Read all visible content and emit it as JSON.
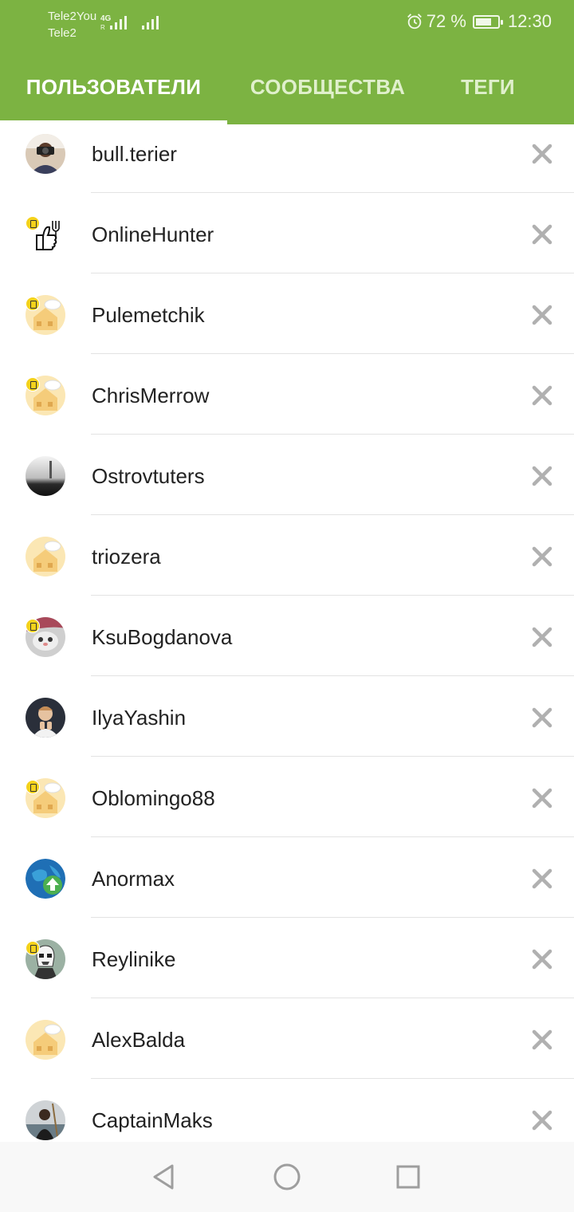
{
  "status_bar": {
    "carrier1": "Tele2You",
    "carrier2": "Tele2",
    "network_type": "4G",
    "roaming": "R",
    "battery_text": "72 %",
    "battery_level": 0.72,
    "time": "12:30"
  },
  "tabs": [
    {
      "label": "ПОЛЬЗОВАТЕЛИ",
      "active": true
    },
    {
      "label": "СООБЩЕСТВА",
      "active": false
    },
    {
      "label": "ТЕГИ",
      "active": false
    }
  ],
  "users": [
    {
      "name": "bull.terier",
      "avatar": "photo-camera-man",
      "badge": false
    },
    {
      "name": "OnlineHunter",
      "avatar": "thumb-fork-drawing",
      "badge": true
    },
    {
      "name": "Pulemetchik",
      "avatar": "default-house",
      "badge": true
    },
    {
      "name": "ChrisMerrow",
      "avatar": "default-house",
      "badge": true
    },
    {
      "name": "Ostrovtuters",
      "avatar": "foggy-landscape",
      "badge": false
    },
    {
      "name": "triozera",
      "avatar": "default-house",
      "badge": false
    },
    {
      "name": "KsuBogdanova",
      "avatar": "cat-photo",
      "badge": true
    },
    {
      "name": "IlyaYashin",
      "avatar": "person-photo",
      "badge": false
    },
    {
      "name": "Oblomingo88",
      "avatar": "default-house",
      "badge": true
    },
    {
      "name": "Anormax",
      "avatar": "globe-arrow",
      "badge": false
    },
    {
      "name": "Reylinike",
      "avatar": "stormtrooper",
      "badge": true
    },
    {
      "name": "AlexBalda",
      "avatar": "default-house",
      "badge": false
    },
    {
      "name": "CaptainMaks",
      "avatar": "dark-person-photo",
      "badge": false
    }
  ],
  "colors": {
    "primary": "#7cb342",
    "remove_icon": "#b0b0b0",
    "divider": "#e3e3e3"
  },
  "nav": {
    "back": "back-icon",
    "home": "home-icon",
    "recents": "recents-icon"
  }
}
